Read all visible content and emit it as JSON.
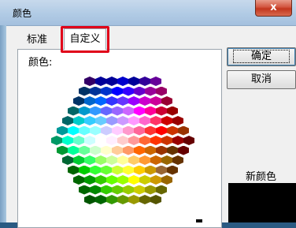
{
  "window": {
    "title": "颜色",
    "close_glyph": "x"
  },
  "tabs": [
    {
      "label": "标准"
    },
    {
      "label": "自定义",
      "selected": true
    }
  ],
  "color_label": "颜色:",
  "buttons": {
    "ok_label": "确定",
    "cancel_label": "取消"
  },
  "new_color_label": "新颜色",
  "new_color_value": "#000000",
  "highlight_color": "#e00019",
  "hex_palette": {
    "rows": [
      [
        "#330066",
        "#000099",
        "#000099",
        "#0000cc",
        "#000099",
        "#330099",
        "#660099"
      ],
      [
        "#003366",
        "#003399",
        "#0033cc",
        "#0000ff",
        "#3300ff",
        "#6600cc",
        "#990099",
        "#990066"
      ],
      [
        "#003366",
        "#0066cc",
        "#0066ff",
        "#3333ff",
        "#6633ff",
        "#9900ff",
        "#cc00cc",
        "#cc0099",
        "#990033"
      ],
      [
        "#006666",
        "#0099cc",
        "#3399ff",
        "#6666ff",
        "#9966ff",
        "#cc66ff",
        "#ff00ff",
        "#ff0099",
        "#cc0033",
        "#990000"
      ],
      [
        "#006666",
        "#00cccc",
        "#33ccff",
        "#66ccff",
        "#9999ff",
        "#cc99ff",
        "#ff99ff",
        "#ff66cc",
        "#ff3366",
        "#cc0000",
        "#990000"
      ],
      [
        "#009999",
        "#00ffff",
        "#66ffff",
        "#99ffff",
        "#ccccff",
        "#ffccff",
        "#ff99cc",
        "#ff6699",
        "#ff3333",
        "#ff0000",
        "#cc3300",
        "#993300"
      ],
      [
        "#009966",
        "#00ffcc",
        "#66ffcc",
        "#ccffff",
        "#ffffff",
        "#ffeeff",
        "#ffcccc",
        "#ff9999",
        "#ff6633",
        "#ff3300",
        "#cc3300",
        "#990000",
        "#660000"
      ],
      [
        "#009933",
        "#00ff99",
        "#66ff99",
        "#ccffcc",
        "#ffffcc",
        "#ffcc99",
        "#ff9966",
        "#ff6600",
        "#cc6600",
        "#993300",
        "#663300",
        "#660000"
      ],
      [
        "#006633",
        "#00cc33",
        "#33ff66",
        "#99ff66",
        "#ccff99",
        "#ffff99",
        "#ffcc66",
        "#ff9933",
        "#cc6600",
        "#996600",
        "#663300"
      ],
      [
        "#006600",
        "#00cc00",
        "#33ff33",
        "#66ff33",
        "#ccff33",
        "#ffff33",
        "#ffcc00",
        "#cc9900",
        "#996633",
        "#663300"
      ],
      [
        "#006600",
        "#009900",
        "#33cc00",
        "#66ff00",
        "#99ff00",
        "#ffff00",
        "#cccc00",
        "#cc9900",
        "#996600"
      ],
      [
        "#006600",
        "#008800",
        "#33cc00",
        "#66cc00",
        "#99cc00",
        "#cccc00",
        "#999900",
        "#666600"
      ],
      [
        "#005500",
        "#006600",
        "#339900",
        "#669900",
        "#999900",
        "#666600",
        "#555500"
      ]
    ]
  }
}
